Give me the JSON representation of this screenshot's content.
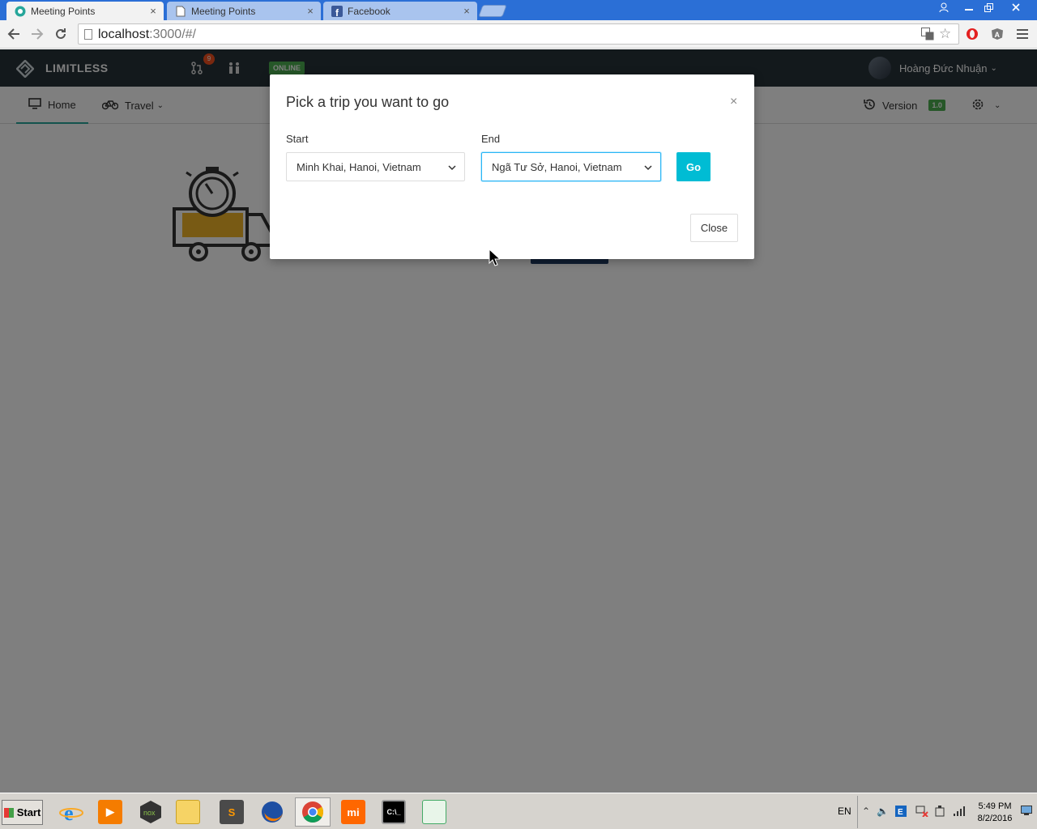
{
  "browser": {
    "tabs": [
      {
        "title": "Meeting Points",
        "active": true,
        "icon": "app-icon"
      },
      {
        "title": "Meeting Points",
        "active": false,
        "icon": "page-icon"
      },
      {
        "title": "Facebook",
        "active": false,
        "icon": "facebook-icon"
      }
    ],
    "tab_close": "×",
    "address": {
      "host": "localhost",
      "rest": ":3000/#/"
    }
  },
  "app": {
    "brand": "LIMITLESS",
    "notification_count": "9",
    "status": "ONLINE",
    "user_name": "Hoàng Đức Nhuận",
    "nav": {
      "home": "Home",
      "travel": "Travel",
      "version_label": "Version",
      "version_badge": "1.0"
    }
  },
  "modal": {
    "title": "Pick a trip you want to go",
    "close_x": "×",
    "start_label": "Start",
    "start_value": "Minh Khai, Hanoi, Vietnam",
    "end_label": "End",
    "end_value": "Ngã Tư Sở, Hanoi, Vietnam",
    "go_label": "Go",
    "close_label": "Close"
  },
  "taskbar": {
    "start_label": "Start",
    "language": "EN",
    "time": "5:49 PM",
    "date": "8/2/2016"
  },
  "colors": {
    "navbar": "#263238",
    "accent": "#00bcd4",
    "online": "#4caf50",
    "tab_strip": "#2b6fd6"
  }
}
